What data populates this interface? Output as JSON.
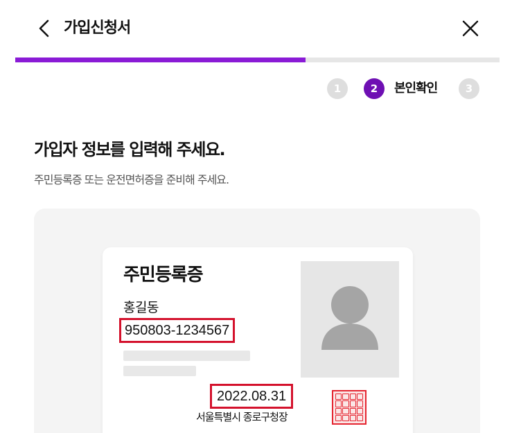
{
  "header": {
    "title": "가입신청서",
    "back_icon": "chevron-left-icon",
    "close_icon": "close-icon"
  },
  "progress": {
    "fraction": 0.6,
    "fill_color": "#8a1bd6",
    "track_color": "#e6e6e6"
  },
  "steps": [
    {
      "number": "1",
      "active": false
    },
    {
      "number": "2",
      "active": true,
      "label": "본인확인"
    },
    {
      "number": "3",
      "active": false
    }
  ],
  "content": {
    "heading": "가입자 정보를 입력해 주세요.",
    "subheading": "주민등록증 또는 운전면허증을 준비해 주세요."
  },
  "id_card": {
    "title": "주민등록증",
    "name": "홍길동",
    "id_number": "950803-1234567",
    "issue_date": "2022.08.31",
    "issuer": "서울특별시 종로구청장",
    "highlight_color": "#d4112c",
    "photo_icon": "person-silhouette-icon",
    "seal_icon": "official-seal-icon"
  }
}
